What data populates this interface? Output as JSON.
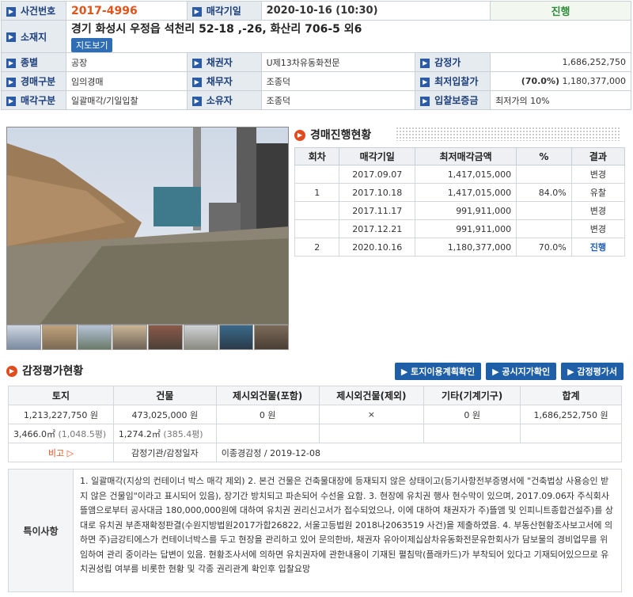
{
  "header": {
    "case_no_label": "사건번호",
    "case_no": "2017-4996",
    "sale_date_label": "매각기일",
    "sale_date": "2020-10-16 (10:30)",
    "status": "진행",
    "location_label": "소재지",
    "address": "경기 화성시 우정읍 석천리 52-18 ,-26, 화산리 706-5 외6",
    "map_button": "지도보기"
  },
  "info": {
    "type_label": "종별",
    "type": "공장",
    "creditor_label": "채권자",
    "creditor": "U제13차유동화전문",
    "appraisal_label": "감정가",
    "appraisal": "1,686,252,750",
    "auction_type_label": "경매구분",
    "auction_type": "임의경매",
    "debtor_label": "채무자",
    "debtor": "조종덕",
    "min_price_label": "최저입찰가",
    "min_price_pct": "(70.0%)",
    "min_price": "1,180,377,000",
    "sale_type_label": "매각구분",
    "sale_type": "일괄매각/기일입찰",
    "owner_label": "소유자",
    "owner": "조종덕",
    "deposit_label": "입찰보증금",
    "deposit": "최저가의 10%"
  },
  "progress": {
    "title": "경매진행현황",
    "headers": [
      "회차",
      "매각기일",
      "최저매각금액",
      "%",
      "결과"
    ],
    "rows": [
      {
        "round": "",
        "date": "2017.09.07",
        "price": "1,417,015,000",
        "pct": "",
        "result": "변경"
      },
      {
        "round": "1",
        "date": "2017.10.18",
        "price": "1,417,015,000",
        "pct": "84.0%",
        "result": "유찰"
      },
      {
        "round": "",
        "date": "2017.11.17",
        "price": "991,911,000",
        "pct": "",
        "result": "변경"
      },
      {
        "round": "",
        "date": "2017.12.21",
        "price": "991,911,000",
        "pct": "",
        "result": "변경"
      },
      {
        "round": "2",
        "date": "2020.10.16",
        "price": "1,180,377,000",
        "pct": "70.0%",
        "result": "진행"
      }
    ]
  },
  "evaluation": {
    "title": "감정평가현황",
    "buttons": [
      "▶ 토지이용계획확인",
      "▶ 공시지가확인",
      "▶ 감정평가서"
    ],
    "headers": [
      "토지",
      "건물",
      "제시외건물(포함)",
      "제시외건물(제외)",
      "기타(기계기구)",
      "합계"
    ],
    "values": [
      "1,213,227,750 원",
      "473,025,000 원",
      "0 원",
      "×",
      "0 원",
      "1,686,252,750 원"
    ],
    "land_area": "3,466.0㎡",
    "land_pyeong": "(1,048.5평)",
    "bldg_area": "1,274.2㎡",
    "bldg_pyeong": "(385.4평)",
    "note_label": "비고 ▷",
    "appraiser_label": "감정기관/감정일자",
    "appraiser": "이종경감정 / 2019-12-08"
  },
  "special": {
    "label": "특이사항",
    "text": "1. 일괄매각(지상의 컨테이너 박스 매각 제외) 2. 본건 건물은 건축물대장에 등재되지 않은 상태이고(등기사항전부증명서에 \"건축법상 사용승인 받지 않은 건물임\"이라고 표시되어 있음), 장기간 방치되고 파손되어 수선을 요함. 3. 현장에 유치권 행사 현수막이 있으며, 2017.09.06자 주식회사 뜰앰으로부터 공사대금 180,000,000원에 대하여 유치권 권리신고서가 접수되었으나, 이에 대하여 채권자가 주)뜰앰 및 인피니트종합건설주)를 상대로 유치권 부존재확정판결(수원지방법원2017가합26822, 서울고등법원 2018나2063519 사건)을 제출하였음. 4. 부동산현황조사보고서에 의하면 주)금강티에스가 컨테이너박스를 두고 현장을 관리하고 있어 문의한바, 채권자 유아이제십삼차유동화전문유한회사가 담보물의 경비업무를 위임하여 관리 중이라는 답변이 있음. 현황조사서에 의하면 유치권자에 관한내용이 기재된 펼침막(플래카드)가 부착되어 있다고 기재되어있으므로 유치권성립 여부를 비롯한 현황 및 각종 권리관계 확인후 입찰요망"
  },
  "colors": {
    "accent": "#e0541b",
    "label_bg": "#e6ebf0",
    "label_text": "#1c3e7a",
    "button": "#1f5fa8",
    "status": "#2e8b3a"
  }
}
